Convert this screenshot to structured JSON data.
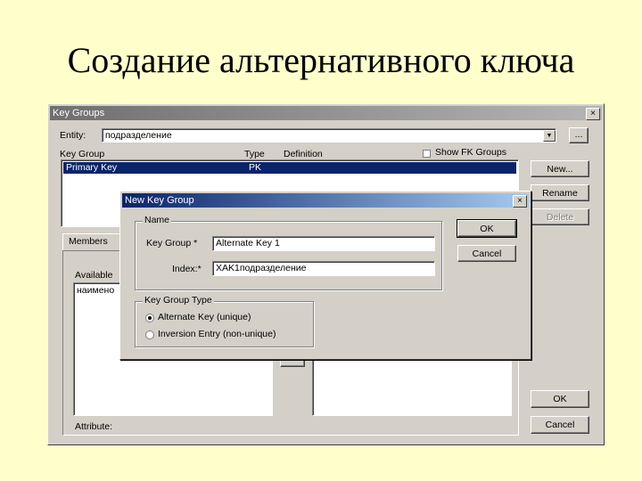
{
  "slide": {
    "title": "Создание альтернативного ключа"
  },
  "key_groups": {
    "title": "Key Groups",
    "close": "×",
    "entity_label": "Entity:",
    "entity_value": "подразделение",
    "entity_dropdown": "▼",
    "entity_browse": "...",
    "columns": [
      "Key Group",
      "Type",
      "Definition"
    ],
    "show_fk_label": "Show FK Groups",
    "rows": [
      {
        "name": "Primary Key",
        "type": "PK",
        "definition": ""
      }
    ],
    "buttons": {
      "new": "New...",
      "rename": "Rename",
      "delete": "Delete",
      "ok": "OK",
      "cancel": "Cancel"
    },
    "members_tab": "Members",
    "available_label": "Available",
    "available_items": [
      "наимено"
    ],
    "attribute_label": "Attribute:"
  },
  "new_key_group": {
    "title": "New Key Group",
    "close": "×",
    "name_group": "Name",
    "key_group_label": "Key Group *",
    "key_group_value": "Alternate Key 1",
    "index_label": "Index:*",
    "index_value": "XAK1подразделение",
    "ok": "OK",
    "cancel": "Cancel",
    "type_group": "Key Group Type",
    "types": [
      {
        "label": "Alternate Key (unique)",
        "selected": true
      },
      {
        "label": "Inversion Entry (non-unique)",
        "selected": false
      }
    ]
  }
}
